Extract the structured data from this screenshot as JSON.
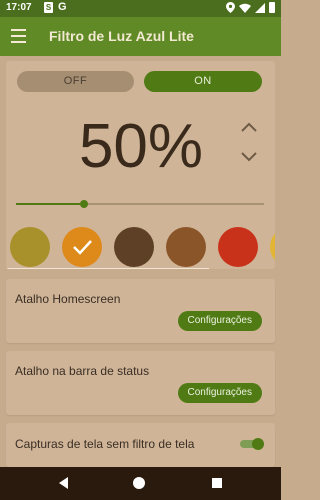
{
  "status_bar": {
    "time": "17:07",
    "icons": [
      "sim-card-icon",
      "google-icon",
      "location-icon",
      "wifi-icon",
      "signal-icon",
      "battery-icon"
    ]
  },
  "toolbar": {
    "title": "Filtro de Luz Azul Lite",
    "menu_icon": "hamburger-menu-icon"
  },
  "filter": {
    "off_label": "OFF",
    "on_label": "ON",
    "active": "ON",
    "intensity_text": "50%",
    "intensity_value": 0.5,
    "up_icon": "chevron-up-icon",
    "down_icon": "chevron-down-icon"
  },
  "colors": {
    "accent": "#4f7a14",
    "toolbar": "#5f8a25",
    "background": "#c6ab8d",
    "swatches": [
      "#a8902a",
      "#de8a1a",
      "#5e4026",
      "#8b552a",
      "#c9321a",
      "#e2b634"
    ],
    "selected_swatch_index": 1
  },
  "shortcuts": {
    "homescreen_label": "Atalho Homescreen",
    "homescreen_button": "Configurações",
    "statusbar_label": "Atalho na barra de status",
    "statusbar_button": "Configurações",
    "screenshot_label": "Capturas de tela sem filtro de tela",
    "screenshot_enabled": true
  },
  "navbar": {
    "back_icon": "back-triangle-icon",
    "home_icon": "home-circle-icon",
    "recents_icon": "recents-square-icon"
  }
}
